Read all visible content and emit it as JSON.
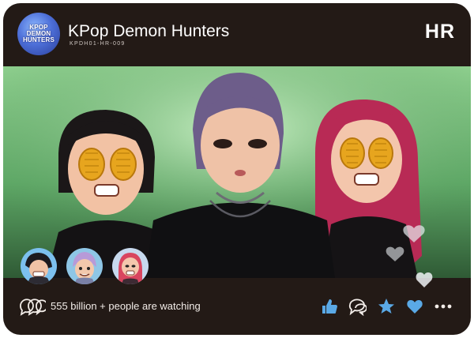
{
  "header": {
    "logo_lines": [
      "KPOP",
      "DEMON",
      "HUNTERS"
    ],
    "title": "KPop Demon Hunters",
    "code": "KPDH01-HR-009",
    "rarity": "HR"
  },
  "footer": {
    "watching_text": "555 billion + people are watching",
    "actions": [
      "thumbs-up-icon",
      "chat-bubble-icon",
      "star-icon",
      "heart-icon",
      "more-dots-icon"
    ]
  },
  "colors": {
    "card_bg": "#231a16",
    "accent_blue": "#5aa9e6",
    "screen_green": "#6cbf72"
  }
}
